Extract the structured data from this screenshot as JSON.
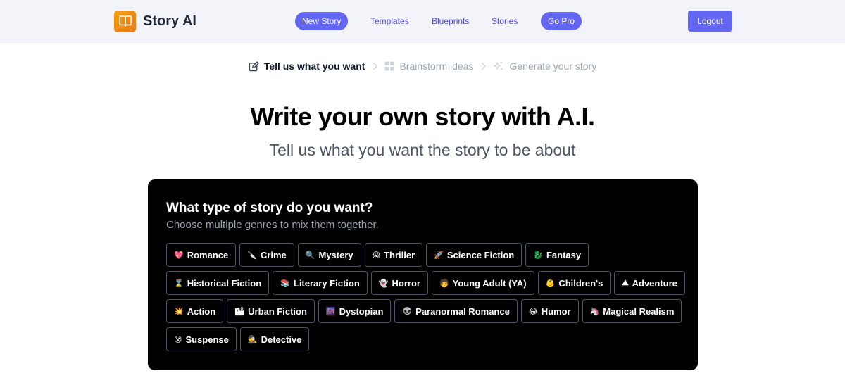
{
  "brand": {
    "name": "Story AI",
    "icon": "open-book-icon"
  },
  "nav": {
    "items": [
      {
        "label": "New Story",
        "style": "pill"
      },
      {
        "label": "Templates",
        "style": "link"
      },
      {
        "label": "Blueprints",
        "style": "link"
      },
      {
        "label": "Stories",
        "style": "link"
      },
      {
        "label": "Go Pro",
        "style": "pill"
      }
    ],
    "logout_label": "Logout"
  },
  "steps": [
    {
      "label": "Tell us what you want",
      "icon": "pencil-square-icon",
      "active": true
    },
    {
      "label": "Brainstorm ideas",
      "icon": "grid-icon",
      "active": false
    },
    {
      "label": "Generate your story",
      "icon": "sparkles-icon",
      "active": false
    }
  ],
  "hero": {
    "title": "Write your own story with A.I.",
    "subtitle": "Tell us what you want the story to be about"
  },
  "panel": {
    "title": "What type of story do you want?",
    "subtitle": "Choose multiple genres to mix them together.",
    "genres": [
      {
        "emoji": "💖",
        "label": "Romance"
      },
      {
        "emoji": "🔪",
        "label": "Crime"
      },
      {
        "emoji": "🔍",
        "label": "Mystery"
      },
      {
        "emoji": "😱",
        "label": "Thriller"
      },
      {
        "emoji": "🚀",
        "label": "Science Fiction"
      },
      {
        "emoji": "🐉",
        "label": "Fantasy"
      },
      {
        "emoji": "⌛",
        "label": "Historical Fiction"
      },
      {
        "emoji": "📚",
        "label": "Literary Fiction"
      },
      {
        "emoji": "👻",
        "label": "Horror"
      },
      {
        "emoji": "🧑",
        "label": "Young Adult (YA)"
      },
      {
        "emoji": "👶",
        "label": "Children's"
      },
      {
        "emoji": "⛰",
        "label": "Adventure"
      },
      {
        "emoji": "💥",
        "label": "Action"
      },
      {
        "emoji": "🏙",
        "label": "Urban Fiction"
      },
      {
        "emoji": "🌆",
        "label": "Dystopian"
      },
      {
        "emoji": "👽",
        "label": "Paranormal Romance"
      },
      {
        "emoji": "😂",
        "label": "Humor"
      },
      {
        "emoji": "🦄",
        "label": "Magical Realism"
      },
      {
        "emoji": "😵",
        "label": "Suspense"
      },
      {
        "emoji": "🕵",
        "label": "Detective"
      }
    ]
  },
  "colors": {
    "accent": "#6366f1",
    "panel_bg": "#000000",
    "topbar_bg": "#f3f4f9"
  }
}
